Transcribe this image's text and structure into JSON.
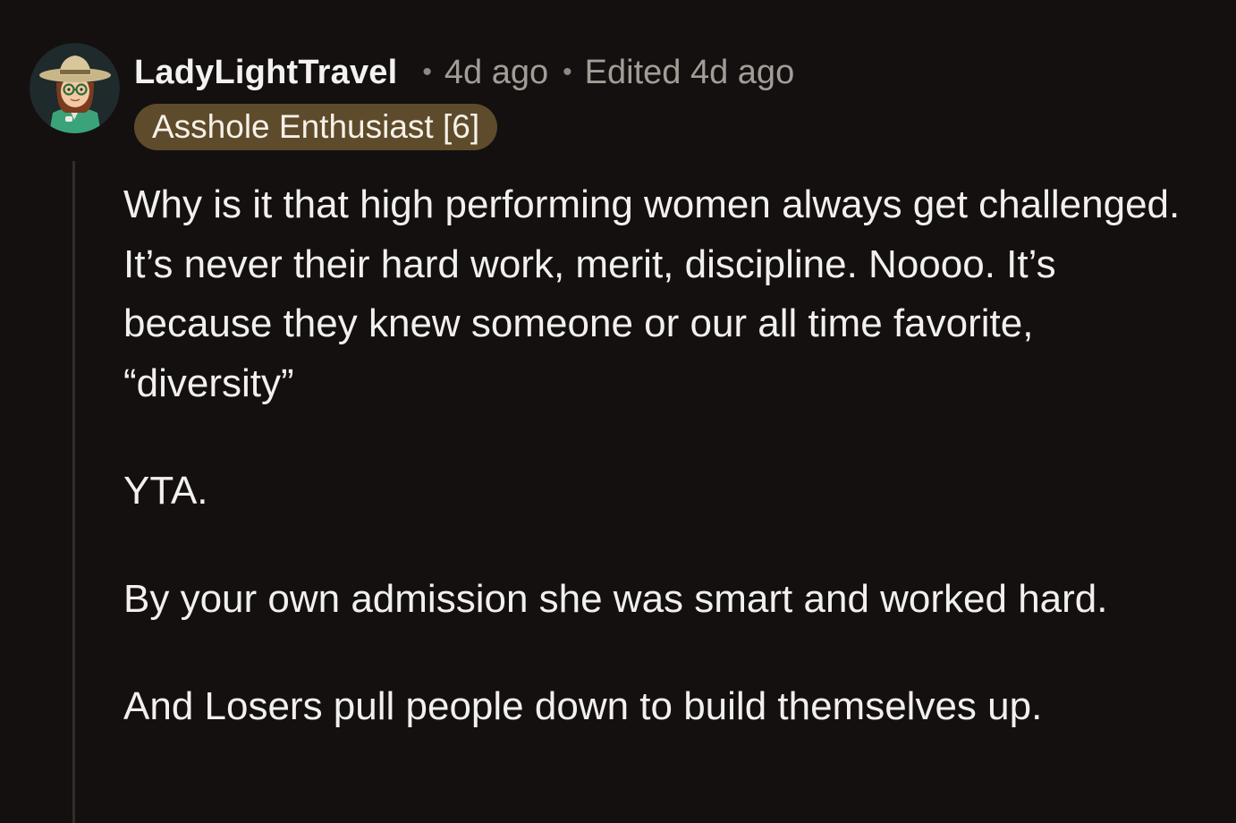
{
  "comment": {
    "author": "LadyLightTravel",
    "posted_ago": "4d ago",
    "edited": "Edited 4d ago",
    "flair": "Asshole Enthusiast [6]",
    "paragraphs": [
      "Why is it that high performing women always get challenged. It’s never their hard work, merit, discipline. Noooo. It’s because they knew someone or our all time favorite, “diversity”",
      "YTA.",
      "By your own admission she was smart and worked hard.",
      "And Losers pull people down to build themselves up."
    ]
  },
  "colors": {
    "background": "#14100f",
    "text": "#f2f0ee",
    "meta": "#a39d98",
    "flair_bg": "#5e4b2b",
    "thread_line": "#332d2a"
  },
  "icons": {
    "avatar": "cowboy-hat-avatar-icon"
  }
}
